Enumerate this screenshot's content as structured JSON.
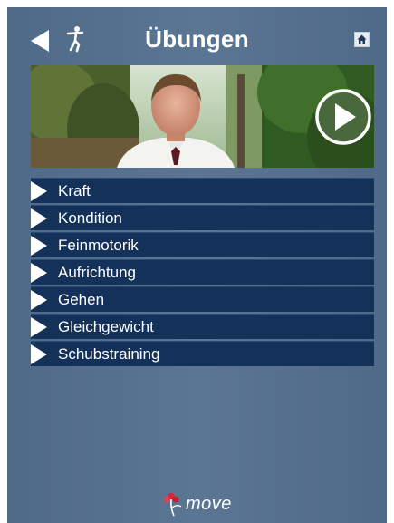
{
  "header": {
    "title": "Übungen",
    "back_icon": "back-arrow-icon",
    "runner_icon": "runner-icon",
    "home_icon": "home-icon"
  },
  "video": {
    "play_icon": "play-icon"
  },
  "menu": {
    "items": [
      {
        "label": "Kraft"
      },
      {
        "label": "Kondition"
      },
      {
        "label": "Feinmotorik"
      },
      {
        "label": "Aufrichtung"
      },
      {
        "label": "Gehen"
      },
      {
        "label": "Gleichgewicht"
      },
      {
        "label": "Schubstraining"
      }
    ]
  },
  "footer": {
    "logo_text": "move"
  },
  "colors": {
    "background": "#56718e",
    "menu_item": "#14315a",
    "text": "#ffffff",
    "logo_flower": "#d8283a"
  }
}
